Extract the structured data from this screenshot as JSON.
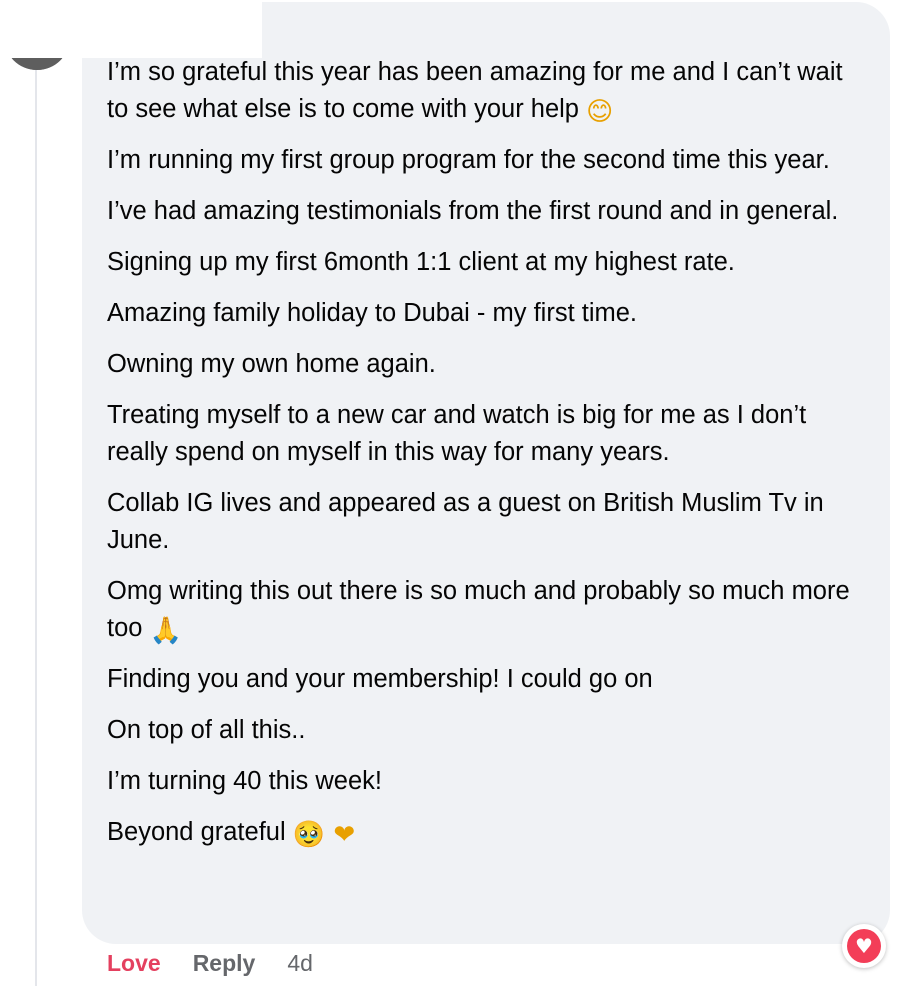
{
  "comment": {
    "paragraphs": [
      {
        "text": "I’m so grateful this year has been amazing for me and I can’t wait to see what else is to come with your help",
        "emoji": "😊",
        "emoji_class": "smile"
      },
      {
        "text": "I’m running my first group program for the second time this year."
      },
      {
        "text": "I’ve had amazing testimonials from the first round and in general."
      },
      {
        "text": "Signing up my first 6month 1:1 client at my highest rate."
      },
      {
        "text": "Amazing family holiday to Dubai - my first time."
      },
      {
        "text": "Owning my own home again."
      },
      {
        "text": "Treating myself to a new car and watch is big for me as I don’t really spend on myself in this way for many years."
      },
      {
        "text": "Collab IG lives and appeared as a guest on British Muslim Tv in June."
      },
      {
        "text": "Omg writing this out there is so much and probably so much more too",
        "emoji": "🙏",
        "emoji_class": "pray"
      },
      {
        "text": "Finding you and your membership! I could go on"
      },
      {
        "text": "On top of all this.."
      },
      {
        "text": "I’m turning 40 this week!"
      },
      {
        "text": "Beyond grateful",
        "emoji": "🥹 ❤",
        "emoji_class": "tear"
      }
    ]
  },
  "actions": {
    "love_label": "Love",
    "reply_label": "Reply",
    "timestamp": "4d"
  },
  "reaction": {
    "icon": "heart-reaction-icon",
    "glyph": "♥",
    "color": "#f33e58"
  }
}
